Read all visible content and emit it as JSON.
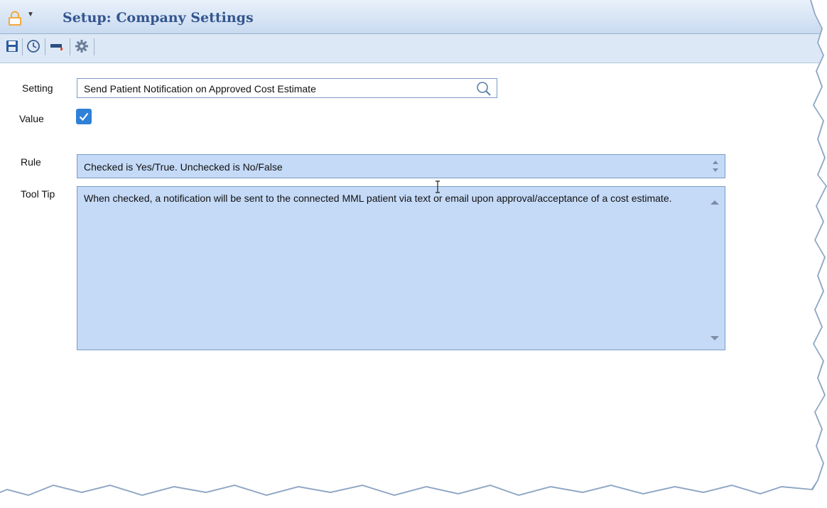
{
  "window": {
    "title": "Setup: Company Settings"
  },
  "toolbar": {
    "buttons": [
      "save-icon",
      "history-clock-icon",
      "graduation-cap-icon",
      "gear-icon"
    ]
  },
  "form": {
    "setting_label": "Setting",
    "setting_value": "Send Patient Notification on Approved Cost Estimate",
    "value_label": "Value",
    "value_checked": true,
    "rule_label": "Rule",
    "rule_value": "Checked is Yes/True. Unchecked is No/False",
    "tooltip_label": "Tool Tip",
    "tooltip_value": "When checked, a notification will be sent to the connected MML patient via text or email upon approval/acceptance of a cost estimate."
  },
  "colors": {
    "title_text": "#34568f",
    "checkbox_accent": "#2f80d8",
    "readonly_field_bg": "#c5daf7",
    "lock_icon": "#f2a93b"
  }
}
